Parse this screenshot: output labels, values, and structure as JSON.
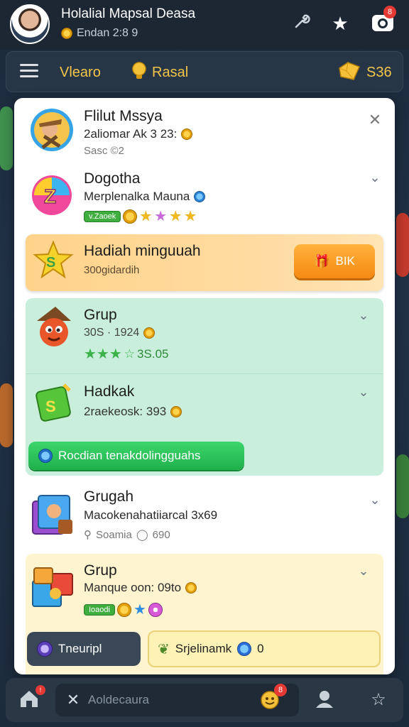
{
  "header": {
    "title": "Holalial Mapsal Deasa",
    "subtitle": "Endan 2:8 9",
    "icons": [
      "wrench-icon",
      "star-icon",
      "camera-icon"
    ],
    "camera_badge": "8"
  },
  "menubar": {
    "menu_label": "Vlearo",
    "hint_label": "Rasal",
    "gems": "S36"
  },
  "items": [
    {
      "title": "Flilut Mssya",
      "sub": "2aliomar Ak 3 23:",
      "meta": "Sasc ©2"
    },
    {
      "title": "Dogotha",
      "sub": "Merplenalka Mauna",
      "level": "v.Zaoek"
    },
    {
      "title": "Hadiah minguuah",
      "sub": "300gidardih",
      "button": "BIK"
    },
    {
      "title": "Grup",
      "sub": "30S · 1924",
      "meta": "3S.05"
    },
    {
      "title": "Hadkak",
      "sub": "2raekeosk: 393",
      "button": "Rocdian tenakdolingguahs"
    },
    {
      "title": "Grugah",
      "sub": "Macokenahatiiarcal 3x69",
      "meta": "Soamia",
      "meta2": "690"
    },
    {
      "title": "Grup",
      "sub": "Manque oon: 09to",
      "level": "Ioaodi"
    }
  ],
  "footer_buttons": {
    "left": "Tneuripl",
    "right": "Srjelinamk",
    "right_count": "0"
  },
  "bottombar": {
    "placeholder": "Aoldecaura",
    "notif_badge": "8"
  },
  "colors": {
    "accent": "#f3c44a",
    "orange": "#f58a12",
    "green": "#20b04c",
    "mint": "#c9efdc"
  }
}
